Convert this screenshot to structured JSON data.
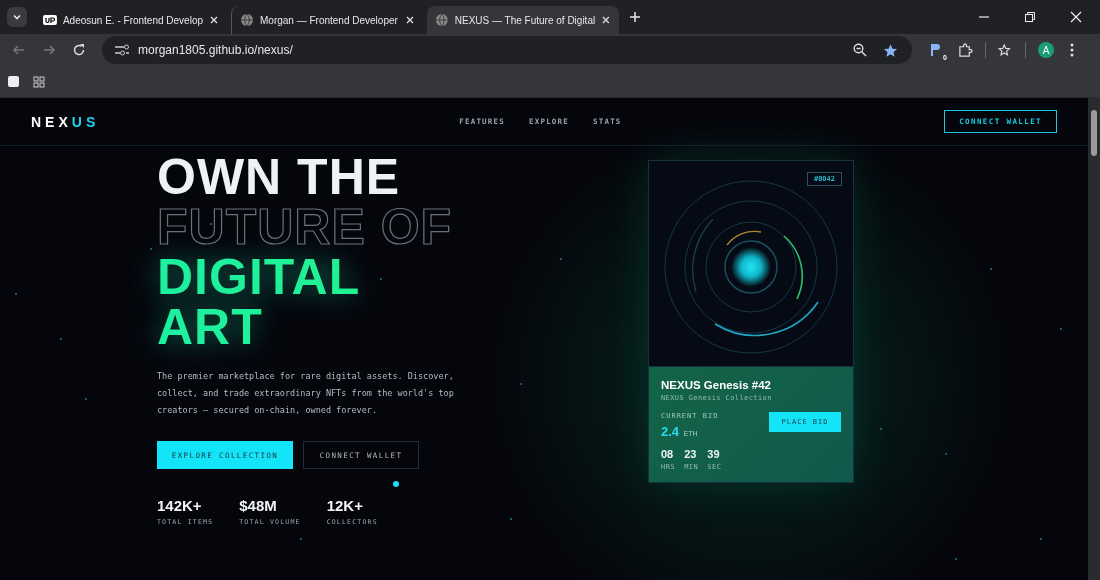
{
  "browser": {
    "tabs": [
      {
        "title": "Adeosun E. - Frontend Develop",
        "selected": false
      },
      {
        "title": "Morgan — Frontend Developer",
        "selected": false
      },
      {
        "title": "NEXUS — The Future of Digital",
        "selected": true
      }
    ],
    "url": "morgan1805.github.io/nexus/",
    "extension_badge": "0",
    "profile_initial": "A"
  },
  "nav": {
    "logo_main": "NEX",
    "logo_accent": "US",
    "links": [
      "FEATURES",
      "EXPLORE",
      "STATS"
    ],
    "cta": "CONNECT WALLET"
  },
  "hero": {
    "title_lines": [
      {
        "text": "OWN THE",
        "kind": "solid"
      },
      {
        "text": "FUTURE OF",
        "kind": "outline"
      },
      {
        "text": "DIGITAL",
        "kind": "gradient"
      },
      {
        "text": "ART",
        "kind": "gradient"
      }
    ],
    "description": "The premier marketplace for rare digital assets. Discover, collect, and trade extraordinary NFTs from the world's top creators — secured on-chain, owned forever.",
    "buttons": [
      {
        "label": "EXPLORE COLLECTION",
        "kind": "primary"
      },
      {
        "label": "CONNECT WALLET",
        "kind": "secondary"
      }
    ],
    "stats": [
      {
        "value": "142K+",
        "label": "TOTAL ITEMS"
      },
      {
        "value": "$48M",
        "label": "TOTAL VOLUME"
      },
      {
        "value": "12K+",
        "label": "COLLECTORS"
      }
    ]
  },
  "card": {
    "token_id": "#0042",
    "title": "NEXUS Genesis #42",
    "collection": "NEXUS Genesis Collection",
    "bid_label": "CURRENT BID",
    "bid_amount": "2.4",
    "bid_currency": "ETH",
    "bid_button": "PLACE BID",
    "countdown": [
      {
        "value": "08",
        "unit": "HRS"
      },
      {
        "value": "23",
        "unit": "MIN"
      },
      {
        "value": "39",
        "unit": "SEC"
      }
    ]
  }
}
